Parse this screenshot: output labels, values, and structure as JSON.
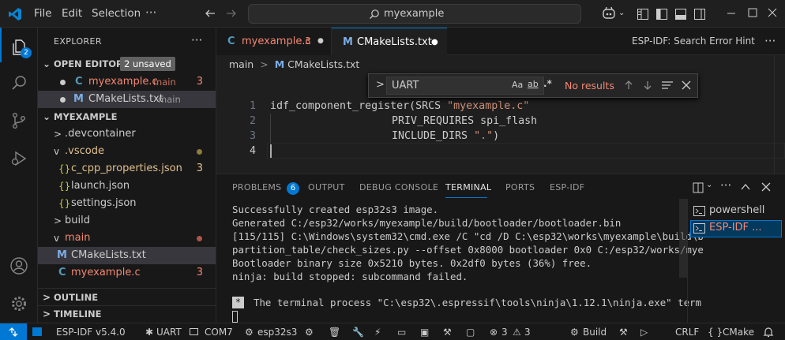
{
  "menu": [
    "File",
    "Edit",
    "Selection"
  ],
  "search": {
    "label": "myexample"
  },
  "activity": {
    "explorer_badge": "2"
  },
  "sidebar": {
    "title": "EXPLORER",
    "open_editors": {
      "label": "OPEN EDITORS",
      "badge": "2 unsaved"
    },
    "open_files": [
      {
        "icon": "C",
        "name": "myexample.c",
        "folder": "main",
        "count": "3"
      },
      {
        "icon": "M",
        "name": "CMakeLists.txt",
        "folder": "main"
      }
    ],
    "project": "MYEXAMPLE",
    "tree": [
      {
        "chev": ">",
        "name": ".devcontainer"
      },
      {
        "chev": "v",
        "name": ".vscode"
      },
      {
        "icon": "{}",
        "name": "c_cpp_properties.json",
        "count": "3"
      },
      {
        "icon": "{}",
        "name": "launch.json"
      },
      {
        "icon": "{}",
        "name": "settings.json"
      },
      {
        "chev": ">",
        "name": "build"
      },
      {
        "chev": "v",
        "name": "main"
      },
      {
        "icon": "M",
        "name": "CMakeLists.txt"
      },
      {
        "icon": "C",
        "name": "myexample.c",
        "count": "3"
      }
    ],
    "outline": "OUTLINE",
    "timeline": "TIMELINE"
  },
  "tabs": [
    {
      "icon": "C",
      "label": "myexample.c",
      "count": "3"
    },
    {
      "icon": "M",
      "label": "CMakeLists.txt"
    }
  ],
  "tabs_right": "ESP-IDF: Search Error Hint",
  "breadcrumb": {
    "folder": "main",
    "file": "CMakeLists.txt"
  },
  "find": {
    "value": "UART",
    "case": "Aa",
    "word": "ab",
    "regex": ".*",
    "result": "No results"
  },
  "code": {
    "line_numbers": [
      "1",
      "2",
      "3",
      "4"
    ],
    "l1_a": "idf_component_register(SRCS ",
    "l1_b": "\"myexample.c\"",
    "l2": "PRIV_REQUIRES spi_flash",
    "l3_a": "INCLUDE_DIRS ",
    "l3_b": "\".\"",
    "l3_c": ")"
  },
  "panel": {
    "tabs": [
      "PROBLEMS",
      "OUTPUT",
      "DEBUG CONSOLE",
      "TERMINAL",
      "PORTS",
      "ESP-IDF"
    ],
    "problems_count": "6",
    "terminal": [
      "Successfully created esp32s3 image.",
      "Generated C:/esp32/works/myexample/build/bootloader/bootloader.bin",
      "[115/115] C:\\Windows\\system32\\cmd.exe /C \"cd /D C:\\esp32\\works\\myexample\\build\\b",
      "partition_table/check_sizes.py --offset 0x8000 bootloader 0x0 C:/esp32/works/mye",
      "Bootloader binary size 0x5210 bytes. 0x2df0 bytes (36%) free.",
      "ninja: build stopped: subcommand failed."
    ],
    "terminal_msg": "The terminal process \"C:\\esp32\\.espressif\\tools\\ninja\\1.12.1\\ninja.exe\" term",
    "terminal_marker": "*",
    "sessions": [
      "powershell",
      "ESP-IDF ..."
    ]
  },
  "status": {
    "idf": "ESP-IDF v5.4.0",
    "uart": "UART",
    "port": "COM7",
    "target": "esp32s3",
    "errors": "3",
    "warnings": "3",
    "build": "Build",
    "eol": "CRLF",
    "lang": "CMake",
    "braces": "{ }"
  },
  "colors": {
    "accent": "#0078d4",
    "modified": "#e2c08d",
    "error": "#f48771",
    "string": "#ce9178"
  }
}
